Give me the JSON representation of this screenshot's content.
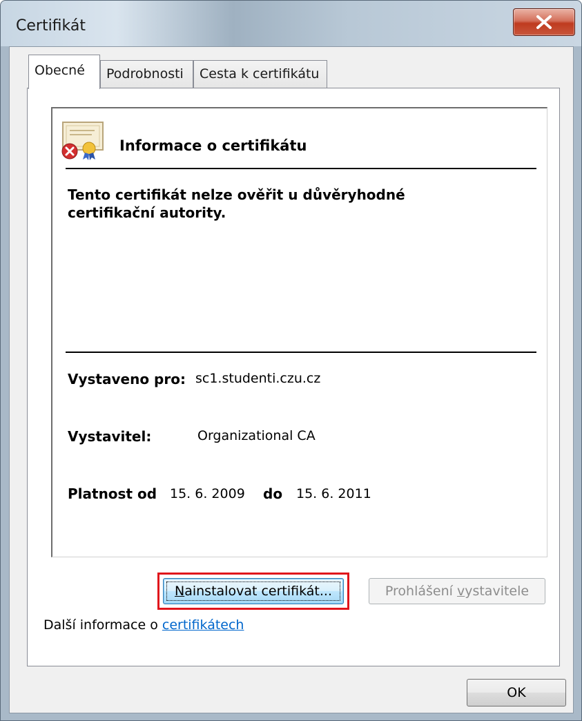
{
  "window": {
    "title": "Certifikát"
  },
  "tabs": [
    {
      "label": "Obecné",
      "active": true
    },
    {
      "label": "Podrobnosti",
      "active": false
    },
    {
      "label": "Cesta k certifikátu",
      "active": false
    }
  ],
  "info": {
    "icon": "certificate-error-icon",
    "title": "Informace o certifikátu",
    "warning": "Tento certifikát nelze ověřit u důvěryhodné certifikační autority.",
    "issued_to_label": "Vystaveno pro:",
    "issued_to_value": "sc1.studenti.czu.cz",
    "issuer_label": "Vystavitel:",
    "issuer_value": "Organizational CA",
    "valid_from_label": "Platnost od",
    "valid_from_value": "15. 6. 2009",
    "valid_to_label": "do",
    "valid_to_value": "15. 6. 2011"
  },
  "buttons": {
    "install_key": "N",
    "install_rest": "ainstalovat certifikát...",
    "issuer_stmt_pre": "Prohlášení ",
    "issuer_stmt_key": "v",
    "issuer_stmt_post": "ystavitele",
    "ok": "OK"
  },
  "more_info": {
    "prefix": "Další informace o ",
    "link": "certifikátech"
  },
  "colors": {
    "highlight": "#e0141b",
    "link": "#0066cc",
    "close_button": "#c8563c"
  }
}
